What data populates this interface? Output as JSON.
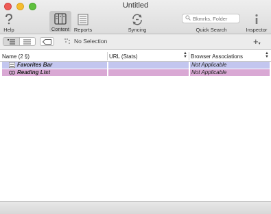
{
  "window": {
    "title": "Untitled"
  },
  "toolbar": {
    "help_label": "Help",
    "content_label": "Content",
    "reports_label": "Reports",
    "syncing_label": "Syncing",
    "search_label": "Quick Search",
    "search_placeholder": "Bkmrks, Folder",
    "inspector_label": "Inspector"
  },
  "subbar": {
    "selection_text": "No Selection",
    "add_menu_arrow": "▾"
  },
  "table": {
    "columns": [
      {
        "label": "Name  (2 §)"
      },
      {
        "label": "URL (Stats)"
      },
      {
        "label": "Browser Associations"
      }
    ],
    "rows": [
      {
        "name": "Favorites Bar",
        "url": "",
        "assoc": "Not Applicable",
        "color": "#c3c6ef"
      },
      {
        "name": "Reading List",
        "url": "",
        "assoc": "Not Applicable",
        "color": "#d9a8d4"
      }
    ]
  },
  "colors": {
    "favorites_row": "#c3c6ef",
    "reading_row": "#d9a8d4",
    "toolbar_bg": "#dcdcdc"
  }
}
